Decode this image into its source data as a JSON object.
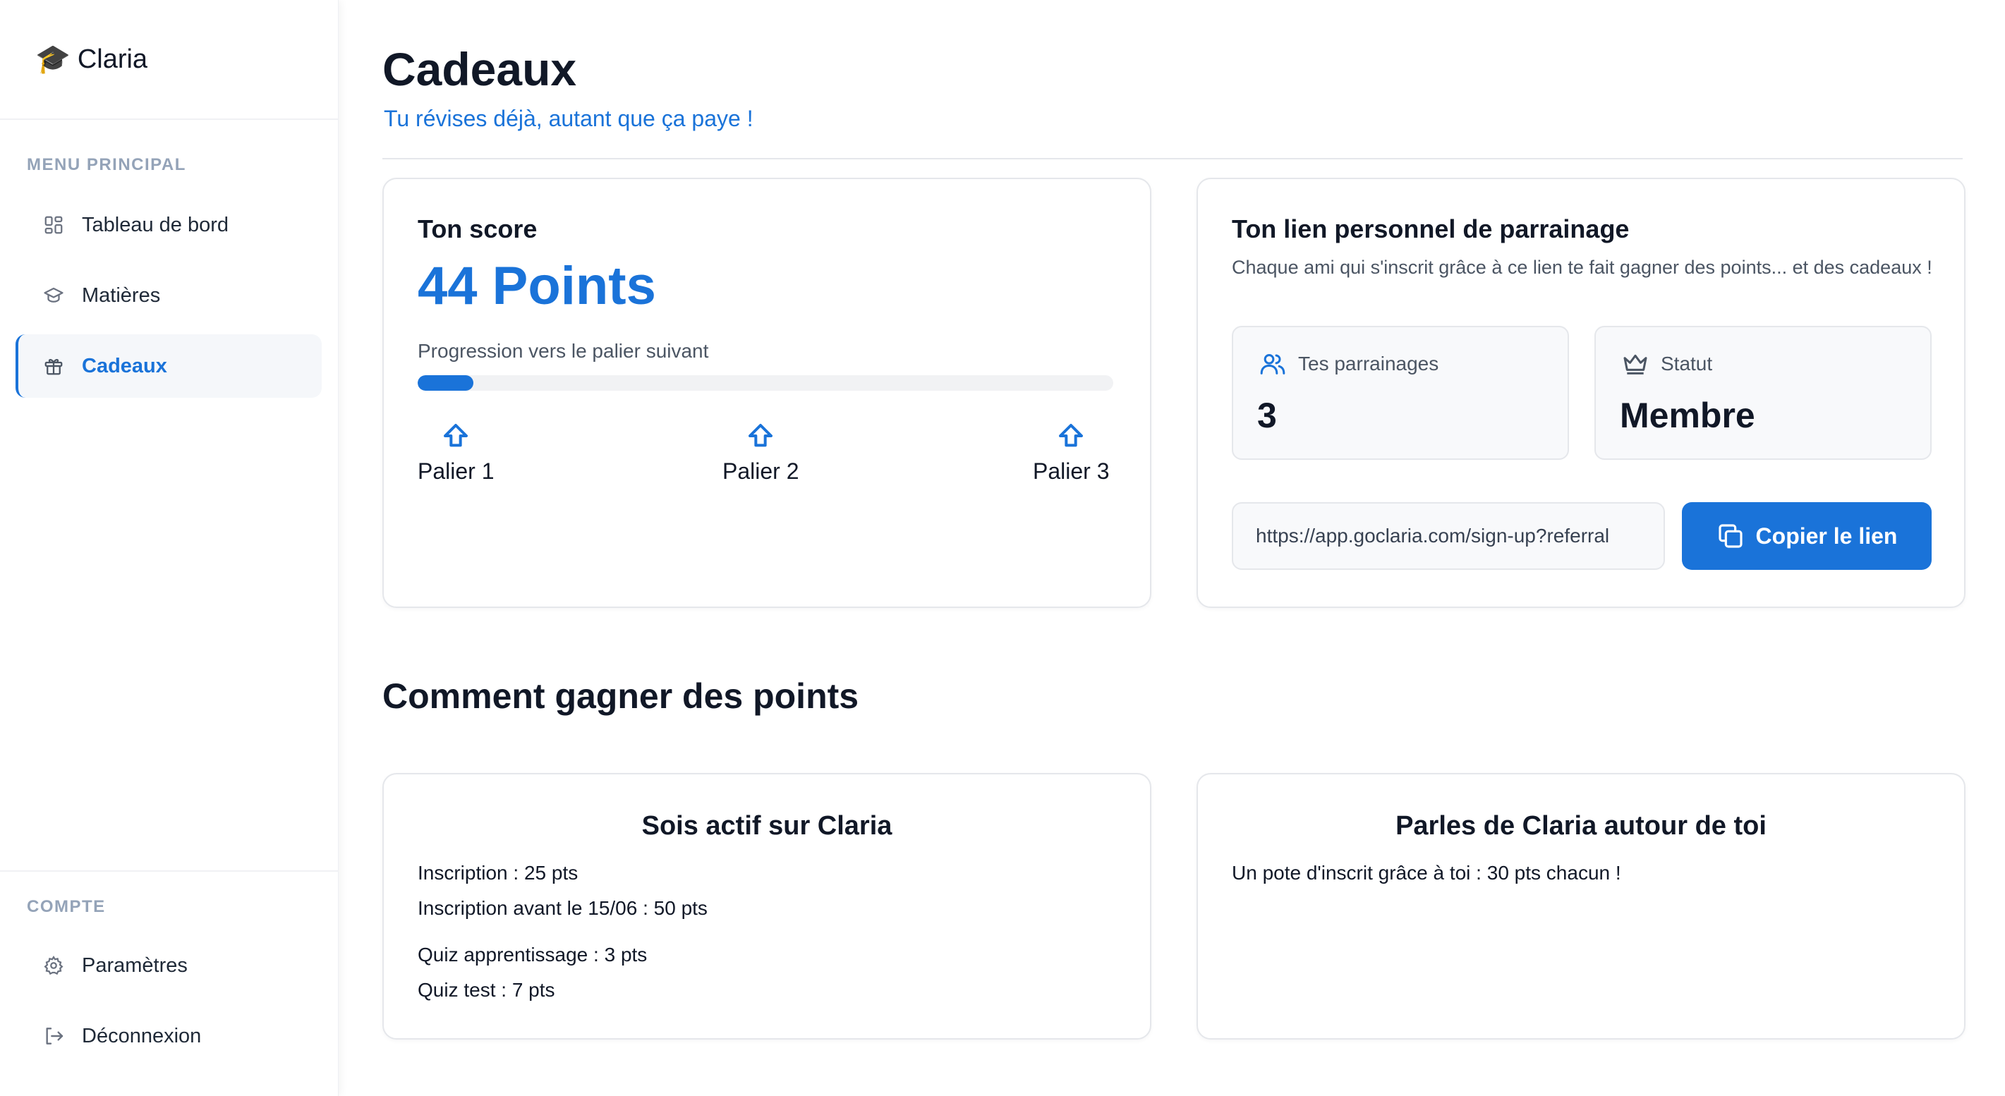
{
  "sidebar": {
    "brand": {
      "icon": "graduation-cap-icon",
      "name": "Claria"
    },
    "main_section_title": "MENU PRINCIPAL",
    "items": [
      {
        "label": "Tableau de bord",
        "icon": "grid-icon",
        "active": false
      },
      {
        "label": "Matières",
        "icon": "graduation-hat-outline-icon",
        "active": false
      },
      {
        "label": "Cadeaux",
        "icon": "gift-icon",
        "active": true
      }
    ],
    "account_section_title": "COMPTE",
    "account_items": [
      {
        "label": "Paramètres",
        "icon": "gear-icon"
      },
      {
        "label": "Déconnexion",
        "icon": "logout-icon"
      }
    ]
  },
  "page": {
    "title": "Cadeaux",
    "subtitle": "Tu révises déjà, autant que ça paye !"
  },
  "score_card": {
    "title": "Ton score",
    "points": "44 Points",
    "progress_label": "Progression vers le palier suivant",
    "progress_fraction": 0.08,
    "tiers": [
      "Palier 1",
      "Palier 2",
      "Palier 3"
    ]
  },
  "referral_card": {
    "title": "Ton lien personnel de parrainage",
    "description": "Chaque ami qui s'inscrit grâce à ce lien te fait gagner des points... et des cadeaux !",
    "referrals_label": "Tes parrainages",
    "referrals_value": "3",
    "status_label": "Statut",
    "status_value": "Membre",
    "link_value": "https://app.goclaria.com/sign-up?referral",
    "copy_button": "Copier le lien"
  },
  "earn_section": {
    "heading": "Comment gagner des points",
    "active_card": {
      "title": "Sois actif sur Claria",
      "lines": [
        "Inscription : 25 pts",
        "Inscription avant le 15/06 : 50 pts",
        "Quiz apprentissage : 3 pts",
        "Quiz test : 7 pts"
      ]
    },
    "referral_card": {
      "title": "Parles de Claria autour de toi",
      "lines": [
        "Un pote d'inscrit grâce à toi : 30 pts chacun !"
      ]
    }
  },
  "colors": {
    "accent": "#1a73d9",
    "muted": "#94a3b8",
    "border": "#e5e7eb"
  }
}
